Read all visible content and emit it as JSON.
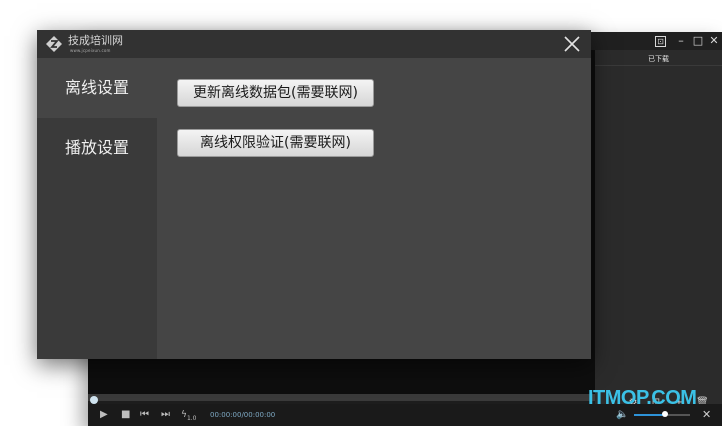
{
  "player": {
    "window_controls": {
      "cast": "⊡",
      "minimize": "–",
      "maximize": "□",
      "close": "✕"
    },
    "playlist_tab": "已下载",
    "playlist_tools": [
      "⚙",
      "⊞",
      "+",
      "🗑"
    ],
    "controls": {
      "play": "▶",
      "stop": "■",
      "prev": "⏮",
      "next": "⏭",
      "speed": "1.0",
      "timecode": "00:00:00/00:00:00",
      "volume_level": 0.55
    },
    "fullscreen": "✕"
  },
  "dialog": {
    "logo_text": "技成培训网",
    "logo_url": "www.jcpeixun.com",
    "sidebar": [
      {
        "label": "离线设置",
        "active": true
      },
      {
        "label": "播放设置",
        "active": false
      }
    ],
    "buttons": {
      "update_package": "更新离线数据包(需要联网)",
      "verify_license": "离线权限验证(需要联网)"
    }
  },
  "watermark": "ITMOP.COM",
  "colors": {
    "dialog_bg": "#454545",
    "sidebar_bg": "#3a3a3a",
    "accent_blue": "#2e93d8",
    "watermark": "#3bc1e6"
  }
}
